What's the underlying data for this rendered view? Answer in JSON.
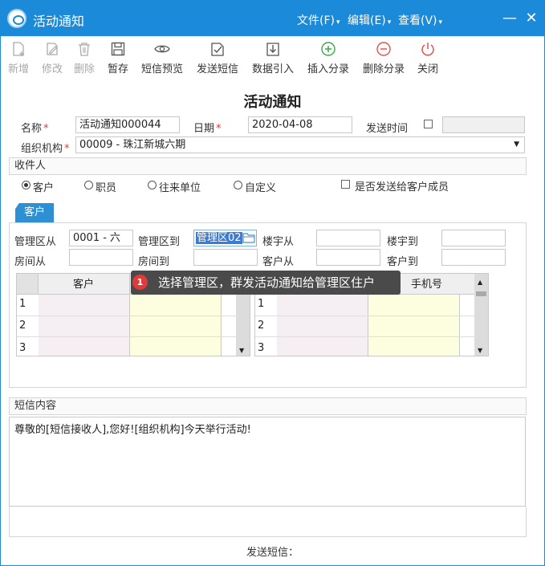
{
  "window": {
    "title": "活动通知",
    "menus": [
      "文件(F)",
      "编辑(E)",
      "查看(V)"
    ],
    "minimize": "—",
    "close": "✕"
  },
  "toolbar": [
    {
      "label": "新增",
      "icon": "new-doc-icon",
      "enabled": false
    },
    {
      "label": "修改",
      "icon": "edit-icon",
      "enabled": false
    },
    {
      "label": "删除",
      "icon": "trash-icon",
      "enabled": false
    },
    {
      "label": "暂存",
      "icon": "save-icon",
      "enabled": true
    },
    {
      "label": "短信预览",
      "icon": "eye-icon",
      "enabled": true
    },
    {
      "label": "发送短信",
      "icon": "send-check-icon",
      "enabled": true
    },
    {
      "label": "数据引入",
      "icon": "import-icon",
      "enabled": true
    },
    {
      "label": "插入分录",
      "icon": "plus-circle-icon",
      "enabled": true
    },
    {
      "label": "删除分录",
      "icon": "minus-circle-icon",
      "enabled": true
    },
    {
      "label": "关闭",
      "icon": "power-icon",
      "enabled": true
    }
  ],
  "form": {
    "title": "活动通知",
    "name_label": "名称",
    "name_value": "活动通知000044",
    "date_label": "日期",
    "date_value": "2020-04-08",
    "send_time_label": "发送时间",
    "org_label": "组织机构",
    "org_value": "00009 - 珠江新城六期",
    "required_mark": "*"
  },
  "recipients": {
    "section_label": "收件人",
    "options": [
      "客户",
      "职员",
      "往来单位",
      "自定义"
    ],
    "selected": "客户",
    "member_checkbox_label": "是否发送给客户成员",
    "tab_label": "客户",
    "filters": {
      "mgmt_from_label": "管理区从",
      "mgmt_from_value": "0001 - 六",
      "mgmt_to_label": "管理区到",
      "mgmt_to_value": "管理区02",
      "building_from_label": "楼宇从",
      "building_to_label": "楼宇到",
      "room_from_label": "房间从",
      "room_to_label": "房间到",
      "customer_from_label": "客户从",
      "customer_to_label": "客户到"
    },
    "left_grid": {
      "header": "客户",
      "rows": [
        "1",
        "2",
        "3"
      ]
    },
    "right_grid": {
      "header": "手机号",
      "rows": [
        "1",
        "2",
        "3"
      ]
    }
  },
  "tooltip": {
    "badge": "1",
    "text": "选择管理区，群发活动通知给管理区住户"
  },
  "sms": {
    "section_label": "短信内容",
    "content": "尊敬的[短信接收人],您好![组织机构]今天举行活动!"
  },
  "footer": {
    "label": "发送短信："
  },
  "colors": {
    "titlebar": "#1b8ad8",
    "tab": "#2f8fd3",
    "required": "#e03b3b",
    "grid_yellow": "#fdfde0",
    "grid_pink": "#f5eff3"
  }
}
